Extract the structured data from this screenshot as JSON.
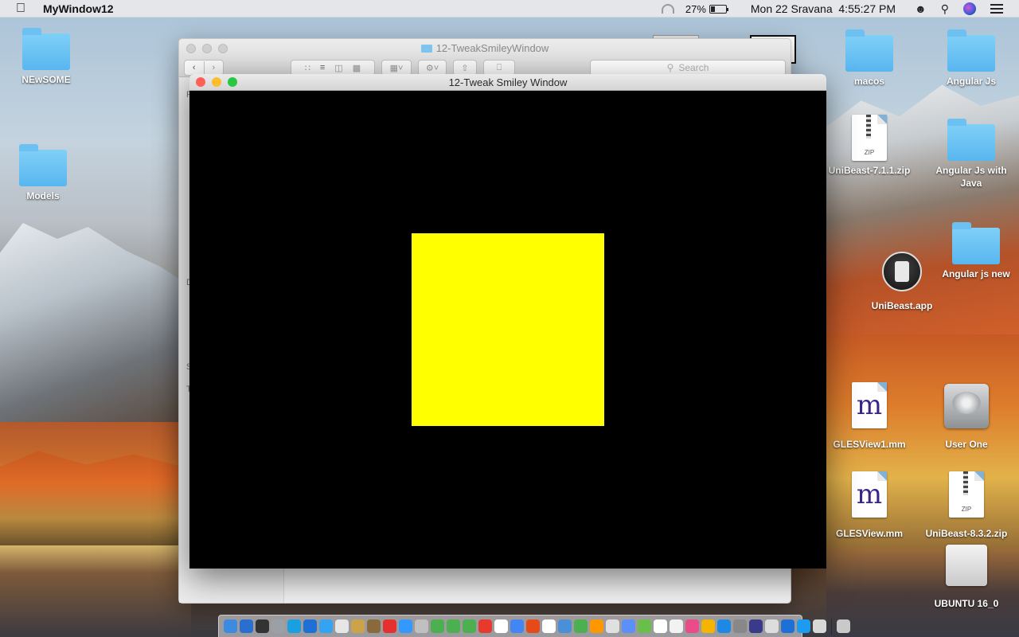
{
  "menubar": {
    "app_name": "MyWindow12",
    "battery": "27%",
    "battery_level": 0.27,
    "clock": "Mon 22 Sravana  4:55:27 PM",
    "icons": [
      "apple-icon",
      "wifi-icon",
      "battery-icon",
      "user-icon",
      "search-icon",
      "siri-icon",
      "notification-center-icon"
    ]
  },
  "desktop": {
    "icons": [
      {
        "label": "NEwSOME",
        "kind": "folder"
      },
      {
        "label": "Models",
        "kind": "folder"
      },
      {
        "label": "macos",
        "kind": "folder"
      },
      {
        "label": "Angular Js",
        "kind": "folder"
      },
      {
        "label": "UniBeast-7.1.1.zip",
        "kind": "zip",
        "badge": "ZIP"
      },
      {
        "label": "Angular Js with Java",
        "kind": "folder"
      },
      {
        "label": "Angular js new",
        "kind": "folder"
      },
      {
        "label": "UniBeast.app",
        "kind": "app"
      },
      {
        "label": "GLESView1.mm",
        "kind": "document",
        "glyph": "m"
      },
      {
        "label": "User One",
        "kind": "disk"
      },
      {
        "label": "GLESView.mm",
        "kind": "document",
        "glyph": "m"
      },
      {
        "label": "UniBeast-8.3.2.zip",
        "kind": "zip",
        "badge": "ZIP"
      },
      {
        "label": "UBUNTU 16_0",
        "kind": "usb-drive"
      }
    ]
  },
  "finder": {
    "title": "12-TweakSmileyWindow",
    "search_placeholder": "Search",
    "sidebar_fragments": [
      "F",
      "D",
      "S",
      "T"
    ]
  },
  "gl_window": {
    "title": "12-Tweak Smiley Window",
    "background_color": "#000000",
    "square_color": "#ffff00",
    "traffic_lights": {
      "close": "#fe5f57",
      "minimize": "#febc2e",
      "zoom": "#28c840"
    }
  },
  "dock": {
    "app_colors": [
      "#3d8be0",
      "#2a6fd0",
      "#333333",
      "#9aa0a6",
      "#1a9fe0",
      "#1e6fd6",
      "#33a3f2",
      "#e6e6e6",
      "#caa34a",
      "#8a6a3c",
      "#e53030",
      "#3399ff",
      "#c0c0c0",
      "#4caf50",
      "#4caf50",
      "#4caf50",
      "#e8392e",
      "#ffffff",
      "#4285f4",
      "#e64a19",
      "#ffffff",
      "#4a90d9",
      "#4caf50",
      "#ff9800",
      "#e0e0e0",
      "#5b8ff9",
      "#6abf4b",
      "#ffffff",
      "#f2f2f2",
      "#ea4c89",
      "#f4b400",
      "#1e88e5",
      "#888888",
      "#3a3a8a",
      "#dddddd",
      "#1e6fd6",
      "#1d9bf0",
      "#d8d8d8",
      "#c9c9c9"
    ],
    "trash_label": "trash-icon"
  }
}
